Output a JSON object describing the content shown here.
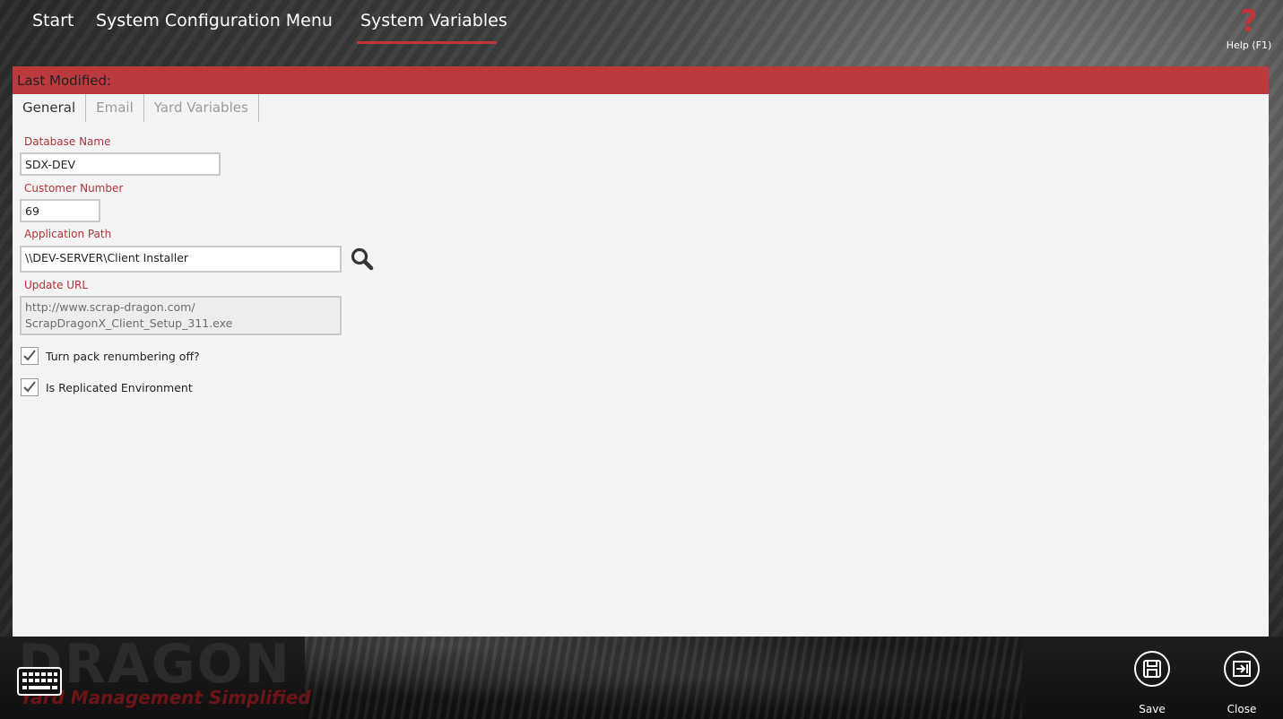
{
  "nav": {
    "start": "Start",
    "config_menu": "System Configuration Menu",
    "system_variables": "System Variables",
    "help_label": "Help (F1)",
    "help_symbol": "?"
  },
  "panel": {
    "last_modified_label": "Last Modified:",
    "tabs": [
      {
        "label": "General",
        "active": true
      },
      {
        "label": "Email",
        "active": false
      },
      {
        "label": "Yard Variables",
        "active": false
      }
    ]
  },
  "form": {
    "database_name": {
      "label": "Database Name",
      "value": "SDX-DEV"
    },
    "customer_number": {
      "label": "Customer Number",
      "value": "69"
    },
    "application_path": {
      "label": "Application Path",
      "value": "\\\\DEV-SERVER\\Client Installer"
    },
    "update_url": {
      "label": "Update URL",
      "value_line1": "http://www.scrap-dragon.com/",
      "value_line2": "ScrapDragonX_Client_Setup_311.exe"
    },
    "pack_renumbering": {
      "label": "Turn pack renumbering off?",
      "checked": true
    },
    "replicated_env": {
      "label": "Is Replicated Environment",
      "checked": true
    }
  },
  "bottom": {
    "logo_text": "DRAGON",
    "logo_tagline": "Yard Management Simplified",
    "save_label": "Save",
    "close_label": "Close"
  },
  "colors": {
    "accent": "#bb3a3e",
    "label_red": "#b0333a",
    "panel_bg": "#f4f4f4"
  },
  "icons": {
    "search": "magnifier-icon",
    "keyboard": "keyboard-icon",
    "save": "floppy-disk-icon",
    "close": "exit-icon",
    "help": "question-mark-icon"
  }
}
